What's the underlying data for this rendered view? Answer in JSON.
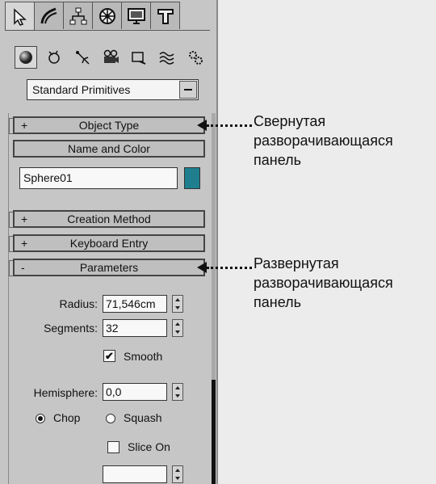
{
  "tabs": [
    {
      "icon": "create-icon",
      "active": true
    },
    {
      "icon": "modify-icon",
      "active": false
    },
    {
      "icon": "hierarchy-icon",
      "active": false
    },
    {
      "icon": "motion-icon",
      "active": false
    },
    {
      "icon": "display-icon",
      "active": false
    },
    {
      "icon": "utilities-icon",
      "active": false
    }
  ],
  "subcategories": [
    {
      "icon": "geometry-icon",
      "active": true
    },
    {
      "icon": "shapes-icon",
      "active": false
    },
    {
      "icon": "lights-icon",
      "active": false
    },
    {
      "icon": "cameras-icon",
      "active": false
    },
    {
      "icon": "helpers-icon",
      "active": false
    },
    {
      "icon": "space-warps-icon",
      "active": false
    },
    {
      "icon": "systems-icon",
      "active": false
    }
  ],
  "dropdown": {
    "value": "Standard Primitives"
  },
  "rollouts": {
    "object_type": {
      "sign": "+",
      "label": "Object Type"
    },
    "name_and_color": {
      "label": "Name and Color"
    },
    "creation_method": {
      "sign": "+",
      "label": "Creation Method"
    },
    "keyboard_entry": {
      "sign": "+",
      "label": "Keyboard Entry"
    },
    "parameters": {
      "sign": "-",
      "label": "Parameters"
    }
  },
  "name_field": {
    "value": "Sphere01",
    "color": "#1f7f8f"
  },
  "parameters": {
    "radius_label": "Radius:",
    "radius_value": "71,546cm",
    "segments_label": "Segments:",
    "segments_value": "32",
    "smooth_label": "Smooth",
    "smooth_checked": "✔",
    "hemisphere_label": "Hemisphere:",
    "hemisphere_value": "0,0",
    "chop_label": "Chop",
    "squash_label": "Squash",
    "slice_on_label": "Slice On"
  },
  "annotations": {
    "collapsed": [
      "Свернутая",
      "разворачивающаяся",
      "панель"
    ],
    "expanded": [
      "Развернутая",
      "разворачивающаяся",
      "панель"
    ]
  }
}
